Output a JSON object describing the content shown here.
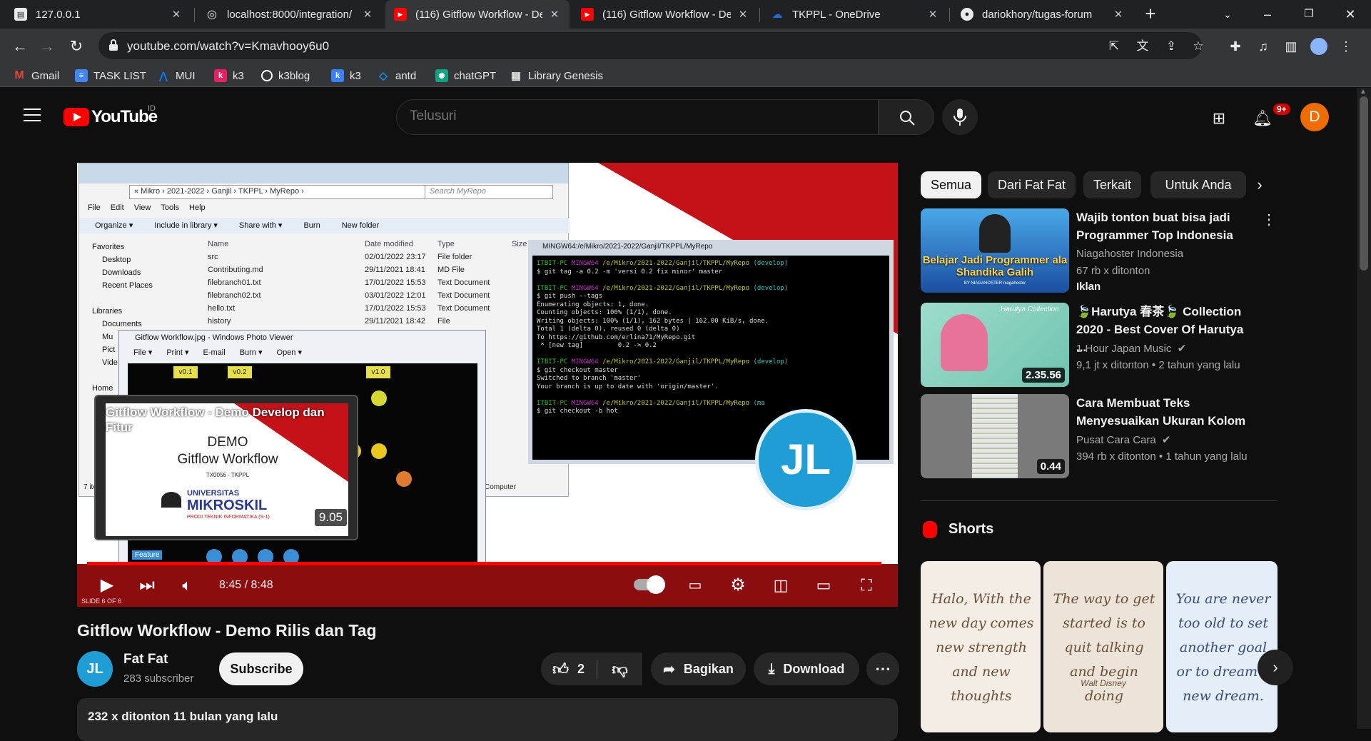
{
  "browser": {
    "tabs": [
      {
        "title": "127.0.0.1",
        "favicon": "page-icon"
      },
      {
        "title": "localhost:8000/integration/",
        "favicon": "globe-icon"
      },
      {
        "title": "(116) Gitflow Workflow - De",
        "favicon": "youtube-icon"
      },
      {
        "title": "(116) Gitflow Workflow - De",
        "favicon": "youtube-icon"
      },
      {
        "title": "TKPPL - OneDrive",
        "favicon": "onedrive-icon"
      },
      {
        "title": "dariokhory/tugas-forum",
        "favicon": "github-icon"
      }
    ],
    "url": "youtube.com/watch?v=Kmavhooy6u0",
    "bookmarks": [
      {
        "label": "Gmail",
        "icon": "gmail-icon",
        "color": "#ea4335"
      },
      {
        "label": "TASK LIST",
        "icon": "list-icon",
        "color": "#4285f4"
      },
      {
        "label": "MUI",
        "icon": "mui-icon",
        "color": "#007fff"
      },
      {
        "label": "k3",
        "icon": "k3-icon",
        "color": "#e91e63"
      },
      {
        "label": "k3blog",
        "icon": "github-icon",
        "color": "#ffffff"
      },
      {
        "label": "k3",
        "icon": "k3-icon",
        "color": "#3b82f6"
      },
      {
        "label": "antd",
        "icon": "antd-icon",
        "color": "#1890ff"
      },
      {
        "label": "chatGPT",
        "icon": "chatgpt-icon",
        "color": "#10a37f"
      },
      {
        "label": "Library Genesis",
        "icon": "library-icon",
        "color": "#dddddd"
      }
    ]
  },
  "youtube": {
    "logo_text": "YouTube",
    "country": "ID",
    "search_placeholder": "Telusuri",
    "notif_count": "9+",
    "avatar_letter": "D"
  },
  "player": {
    "time": "8:45 / 8:48",
    "progress": 0.994,
    "slide_label": "SLIDE 6 OF 6",
    "explorer": {
      "address": "«  Mikro  ›  2021-2022  ›  Ganjil  ›  TKPPL  ›  MyRepo  ›",
      "search": "Search MyRepo",
      "menu": [
        "File",
        "Edit",
        "View",
        "Tools",
        "Help"
      ],
      "commands": [
        "Organize ▾",
        "Include in library ▾",
        "Share with ▾",
        "Burn",
        "New folder"
      ],
      "nav": [
        "Favorites",
        "Desktop",
        "Downloads",
        "Recent Places",
        "",
        "Libraries",
        "Documents",
        "Mu",
        "Pict",
        "Vide",
        "",
        "Home"
      ],
      "headers": [
        "Name",
        "Date modified",
        "Type",
        "Size"
      ],
      "files": [
        [
          "src",
          "02/01/2022 23:17",
          "File folder"
        ],
        [
          "Contributing.md",
          "29/11/2021 18:41",
          "MD File"
        ],
        [
          "filebranch01.txt",
          "17/01/2022 15:53",
          "Text Document"
        ],
        [
          "filebranch02.txt",
          "03/01/2022 12:01",
          "Text Document"
        ],
        [
          "hello.txt",
          "17/01/2022 15:53",
          "Text Document"
        ],
        [
          "history",
          "29/11/2021 18:42",
          "File"
        ]
      ],
      "status_items": "7 ite",
      "status_computer": "Computer"
    },
    "terminal": {
      "title": "MINGW64:/e/Mikro/2021-2022/Ganjil/TKPPL/MyRepo",
      "prompt_user": "ITBIT-PC",
      "prompt_host": "MINGW64",
      "prompt_path": "/e/Mikro/2021-2022/Ganjil/TKPPL/MyRepo",
      "branch_develop": "(develop)",
      "branch_master": "(ma",
      "cmd1": "$ git tag -a 0.2 -m 'versi 0.2 fix minor' master",
      "cmd2": "$ git push --tags",
      "out2": "Enumerating objects: 1, done.\nCounting objects: 100% (1/1), done.\nWriting objects: 100% (1/1), 162 bytes | 162.00 KiB/s, done.\nTotal 1 (delta 0), reused 0 (delta 0)\nTo https://github.com/erlina71/MyRepo.git\n * [new tag]         0.2 -> 0.2",
      "cmd3": "$ git checkout master",
      "out3": "Switched to branch 'master'\nYour branch is up to date with 'origin/master'.",
      "cmd4": "$ git checkout -b hot"
    },
    "photoviewer": {
      "title": "Gitflow Workflow.jpg - Windows Photo Viewer",
      "menu": [
        "File ▾",
        "Print ▾",
        "E-mail",
        "Burn ▾",
        "Open ▾"
      ],
      "tags": [
        "v0.1",
        "v0.2",
        "v1.0"
      ],
      "feature_label": "Feature"
    },
    "logo_text": "JL",
    "preview": {
      "title": "Gitflow Workflow - Demo Develop dan Fitur",
      "line1": "DEMO",
      "line2": "Gitflow Workflow",
      "code": "TX0056 - TKPPL",
      "university": "UNIVERSITAS",
      "university_name": "MIKROSKIL",
      "university_sub": "PRODI TEKNIK INFORMATIKA (S-1)",
      "duration": "9.05"
    }
  },
  "video": {
    "title": "Gitflow Workflow - Demo Rilis dan Tag",
    "channel": "Fat Fat",
    "channel_initials": "JL",
    "subscribers": "283 subscriber",
    "subscribe": "Subscribe",
    "likes": "2",
    "share": "Bagikan",
    "download": "Download",
    "description": "232 x ditonton  11 bulan yang lalu"
  },
  "chips": [
    "Semua",
    "Dari Fat Fat",
    "Terkait",
    "Untuk Anda"
  ],
  "recommendations": [
    {
      "title": "Wajib tonton buat bisa jadi Programmer Top Indonesia",
      "channel": "Niagahoster Indonesia",
      "meta": "67 rb x ditonton",
      "badge": "Iklan",
      "thumb_text": "Belajar Jadi Programmer ala Shandika Galih",
      "thumb_sub": "BY NIAGAHOSTER  niagahoster"
    },
    {
      "title": "🍃Harutya 春茶🍃 Collection 2020 - Best Cover Of Harutya ...",
      "channel": "1 Hour Japan Music",
      "meta": "9,1 jt x ditonton  •  2 tahun yang lalu",
      "duration": "2.35.56",
      "thumb_text": "Harutya Collection"
    },
    {
      "title": "Cara Membuat Teks Menyesuaikan Ukuran Kolom",
      "channel": "Pusat Cara Cara",
      "meta": "394 rb x ditonton  •  1 tahun yang lalu",
      "duration": "0.44"
    }
  ],
  "shorts": {
    "label": "Shorts",
    "items": [
      {
        "text": "Halo, With the new day comes new strength and new thoughts",
        "bg": "#f3ede4",
        "color": "#6b4f3a"
      },
      {
        "text": "The way to get started is to quit talking and begin doing",
        "author": "Walt Disney",
        "bg": "#ece4d8",
        "color": "#6b4f3a"
      },
      {
        "text": "You are never too old to set another goal or to dream a new dream.",
        "bg": "#e3eef8",
        "color": "#3a4a7a"
      }
    ]
  },
  "colors": {
    "youtube_red": "#ff0000",
    "background": "#0f0f0f",
    "accent_avatar": "#ef6c00"
  }
}
